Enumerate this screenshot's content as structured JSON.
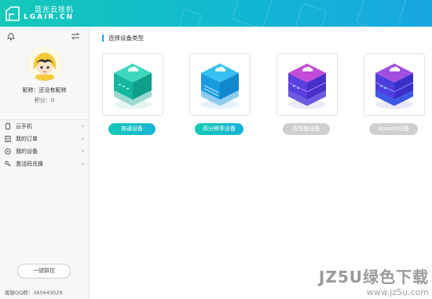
{
  "app": {
    "name_cn": "蓝光云挂机",
    "name_en": "LGAIR.CN"
  },
  "profile": {
    "nickname": "昵称：还没有昵称",
    "points": "积分：0"
  },
  "menu": [
    {
      "label": "云手机",
      "icon": "phone-icon"
    },
    {
      "label": "我的订单",
      "icon": "order-icon"
    },
    {
      "label": "我的设备",
      "icon": "device-icon"
    },
    {
      "label": "激活码兑换",
      "icon": "key-icon"
    }
  ],
  "sidebar": {
    "one_click": "一键群控",
    "qq_group": "客服QQ群：365643029"
  },
  "main": {
    "section_title": "选择设备类型",
    "devices": [
      {
        "label": "普通设备",
        "enabled": true,
        "color": "#14c2a8"
      },
      {
        "label": "高分辨率设备",
        "enabled": true,
        "color": "#17a9e2"
      },
      {
        "label": "高性能设备",
        "enabled": false,
        "color": "#6a3fe0"
      },
      {
        "label": "Xposed设备",
        "enabled": false,
        "color": "#5b46e8"
      }
    ]
  },
  "watermark": {
    "text": "JZ5U绿色下载",
    "url": "www.jz5u.com"
  },
  "colors": {
    "titlebar": "#13c1c6",
    "accent": "#1aa6e6",
    "enabled_button": "#14c2b8",
    "disabled_button": "#cfcfcf"
  }
}
